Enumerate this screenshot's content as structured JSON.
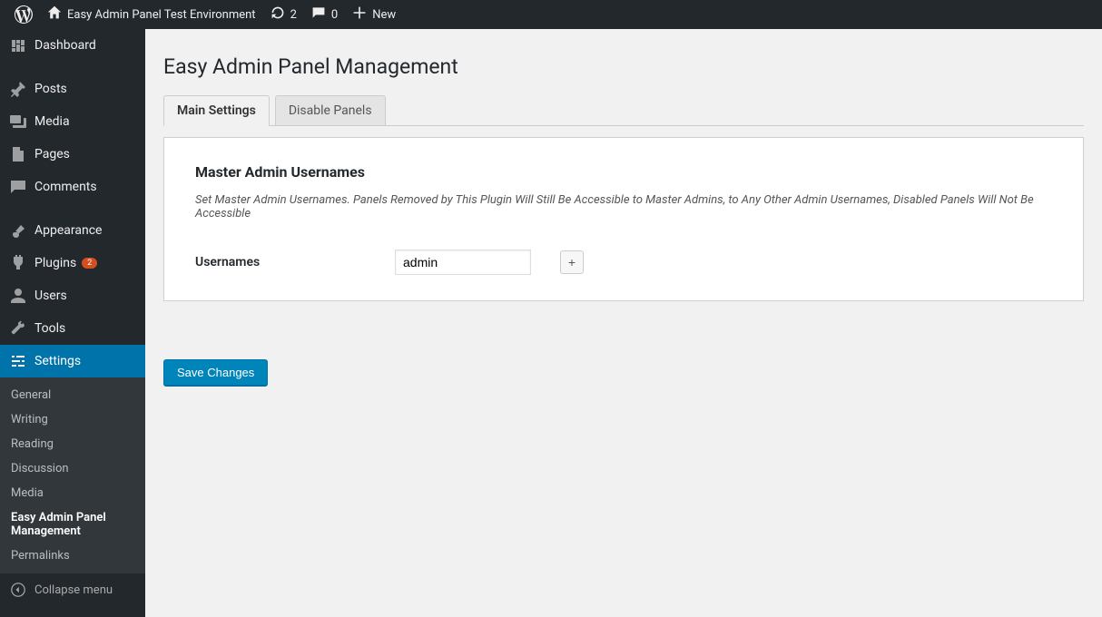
{
  "topbar": {
    "site_name": "Easy Admin Panel Test Environment",
    "updates_count": "2",
    "comments_count": "0",
    "new_label": "New"
  },
  "sidebar": {
    "items": {
      "dashboard": "Dashboard",
      "posts": "Posts",
      "media": "Media",
      "pages": "Pages",
      "comments": "Comments",
      "appearance": "Appearance",
      "plugins": "Plugins",
      "plugins_badge": "2",
      "users": "Users",
      "tools": "Tools",
      "settings": "Settings"
    },
    "submenu": {
      "general": "General",
      "writing": "Writing",
      "reading": "Reading",
      "discussion": "Discussion",
      "media": "Media",
      "eapm": "Easy Admin Panel Management",
      "permalinks": "Permalinks"
    },
    "collapse": "Collapse menu"
  },
  "page": {
    "title": "Easy Admin Panel Management",
    "tabs": {
      "main": "Main Settings",
      "disable": "Disable Panels"
    },
    "panel": {
      "heading": "Master Admin Usernames",
      "desc": "Set Master Admin Usernames. Panels Removed by This Plugin Will Still Be Accessible to Master Admins, to Any Other Admin Usernames, Disabled Panels Will Not Be Accessible",
      "field_label": "Usernames",
      "username_value": "admin",
      "add_label": "+"
    },
    "save": "Save Changes"
  }
}
